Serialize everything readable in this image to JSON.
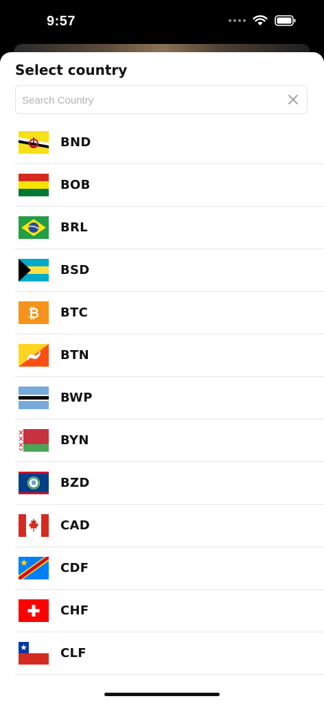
{
  "status_bar": {
    "time": "9:57"
  },
  "sheet": {
    "title": "Select country",
    "search": {
      "placeholder": "Search Country",
      "value": ""
    },
    "currencies": [
      {
        "code": "BND",
        "flag": "brunei-flag"
      },
      {
        "code": "BOB",
        "flag": "bolivia-flag"
      },
      {
        "code": "BRL",
        "flag": "brazil-flag"
      },
      {
        "code": "BSD",
        "flag": "bahamas-flag"
      },
      {
        "code": "BTC",
        "flag": "bitcoin-icon"
      },
      {
        "code": "BTN",
        "flag": "bhutan-flag"
      },
      {
        "code": "BWP",
        "flag": "botswana-flag"
      },
      {
        "code": "BYN",
        "flag": "belarus-flag"
      },
      {
        "code": "BZD",
        "flag": "belize-flag"
      },
      {
        "code": "CAD",
        "flag": "canada-flag"
      },
      {
        "code": "CDF",
        "flag": "dr-congo-flag"
      },
      {
        "code": "CHF",
        "flag": "switzerland-flag"
      },
      {
        "code": "CLF",
        "flag": "chile-flag"
      }
    ]
  },
  "colors": {
    "background": "#000000",
    "sheet": "#ffffff",
    "divider": "#e6e6e6",
    "text": "#111111"
  }
}
